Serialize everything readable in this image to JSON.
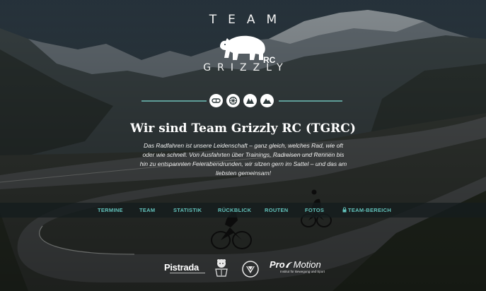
{
  "brand": {
    "line1": "TEAM",
    "badge": "RC",
    "line2": "GRIZZLY"
  },
  "category_icons": [
    "cycling-glasses-icon",
    "bike-wheel-icon",
    "mountain-group-icon",
    "mountain-icon"
  ],
  "headline": "Wir sind Team Grizzly RC (TGRC)",
  "intro": "Das Radfahren ist unsere Leidenschaft – ganz gleich, welches Rad, wie oft oder wie schnell. Von Ausfahrten über Trainings, Radreisen und Rennen bis hin zu entspannten Feierabendrunden, wir sitzen gern im Sattel – und das am liebsten gemeinsam!",
  "nav": {
    "items": [
      "TERMINE",
      "TEAM",
      "STATISTIK",
      "RÜCKBLICK",
      "ROUTEN",
      "FOTOS"
    ],
    "members": "TEAM-BEREICH",
    "members_icon": "lock-icon"
  },
  "sponsors": {
    "pistrada": "Pistrada",
    "promotion_a": "Pro",
    "promotion_b": "Motion",
    "promotion_tagline": "Institut für Bewegung und Sport"
  },
  "colors": {
    "accent": "#62c2bb",
    "divider": "#5e9d97",
    "nav_bg": "#141c1e"
  }
}
